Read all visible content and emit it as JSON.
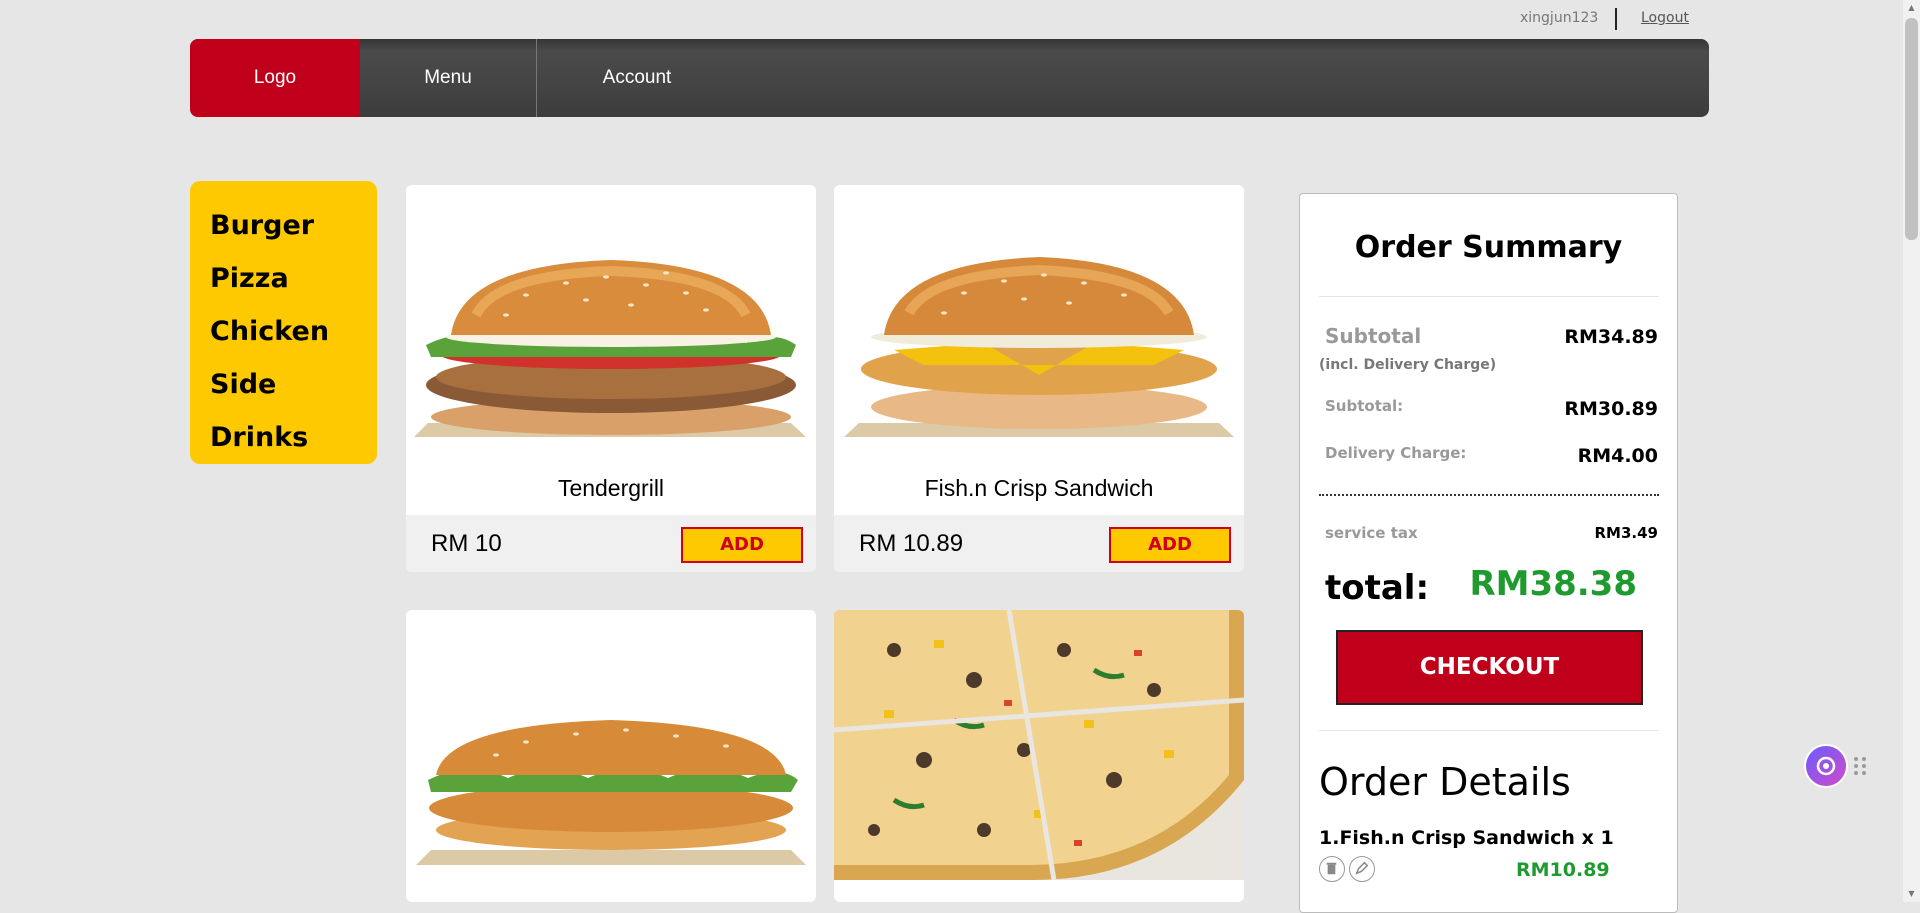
{
  "topbar": {
    "username": "xingjun123",
    "logout": "Logout"
  },
  "nav": {
    "logo": "Logo",
    "menu": "Menu",
    "account": "Account"
  },
  "categories": [
    "Burger",
    "Pizza",
    "Chicken",
    "Side",
    "Drinks"
  ],
  "products": [
    {
      "name": "Tendergrill",
      "price": "RM 10",
      "add": "ADD"
    },
    {
      "name": "Fish.n Crisp Sandwich",
      "price": "RM 10.89",
      "add": "ADD"
    }
  ],
  "summary": {
    "title": "Order Summary",
    "subtotal_incl_label": "Subtotal",
    "subtotal_incl_note": "(incl. Delivery Charge)",
    "subtotal_incl_value": "RM34.89",
    "subtotal_label": "Subtotal:",
    "subtotal_value": "RM30.89",
    "delivery_label": "Delivery Charge:",
    "delivery_value": "RM4.00",
    "tax_label": "service tax",
    "tax_value": "RM3.49",
    "total_label": "total:",
    "total_value": "RM38.38",
    "checkout": "CHECKOUT"
  },
  "order_details": {
    "title": "Order Details",
    "items": [
      {
        "label": "1.Fish.n Crisp Sandwich x 1",
        "price": "RM10.89"
      }
    ]
  },
  "colors": {
    "brand_red": "#c0001a",
    "accent_yellow": "#ffc900",
    "price_green": "#1e9a2e",
    "nav_dark": "#444444"
  }
}
